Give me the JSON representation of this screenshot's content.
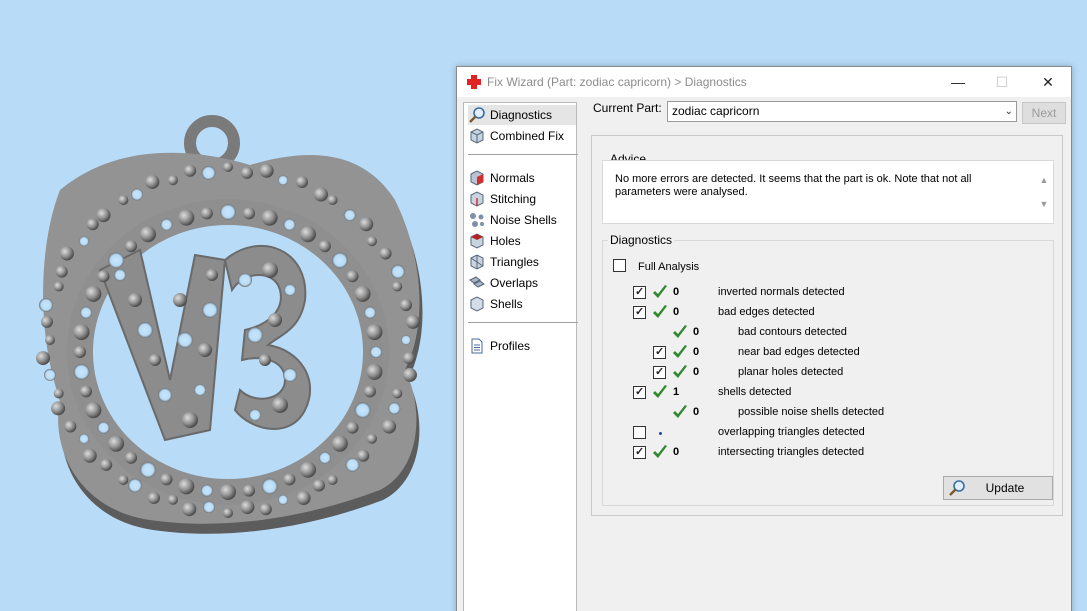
{
  "window": {
    "title": "Fix Wizard (Part: zodiac capricorn) > Diagnostics",
    "controls": {
      "minimize": "—",
      "maximize": "☐",
      "close": "✕"
    }
  },
  "nav": {
    "items": [
      {
        "label": "Diagnostics",
        "icon": "magnifier-icon",
        "selected": true
      },
      {
        "label": "Combined Fix",
        "icon": "cube-icon"
      },
      {
        "label": "Normals",
        "icon": "normals-icon"
      },
      {
        "label": "Stitching",
        "icon": "stitching-icon"
      },
      {
        "label": "Noise Shells",
        "icon": "noise-shells-icon"
      },
      {
        "label": "Holes",
        "icon": "holes-icon"
      },
      {
        "label": "Triangles",
        "icon": "triangles-icon"
      },
      {
        "label": "Overlaps",
        "icon": "overlaps-icon"
      },
      {
        "label": "Shells",
        "icon": "shells-icon"
      },
      {
        "label": "Profiles",
        "icon": "document-icon"
      }
    ]
  },
  "current_part": {
    "label": "Current Part:",
    "value": "zodiac capricorn"
  },
  "next_label": "Next",
  "advice": {
    "title": "Advice",
    "text": "No more errors are detected. It seems that the part is ok. Note that not all parameters were analysed."
  },
  "diagnostics": {
    "title": "Diagnostics",
    "full_analysis": {
      "label": "Full Analysis",
      "checked": false
    },
    "rows": [
      {
        "checkbox": true,
        "checked": true,
        "status": "ok",
        "count": "0",
        "label": "inverted normals detected",
        "indent": 0
      },
      {
        "checkbox": true,
        "checked": true,
        "status": "ok",
        "count": "0",
        "label": "bad edges detected",
        "indent": 0
      },
      {
        "checkbox": false,
        "checked": false,
        "status": "ok",
        "count": "0",
        "label": "bad contours detected",
        "indent": 1
      },
      {
        "checkbox": true,
        "checked": true,
        "status": "ok",
        "count": "0",
        "label": "near bad edges detected",
        "indent": 1
      },
      {
        "checkbox": true,
        "checked": true,
        "status": "ok",
        "count": "0",
        "label": "planar holes detected",
        "indent": 1
      },
      {
        "checkbox": true,
        "checked": true,
        "status": "ok",
        "count": "1",
        "label": "shells detected",
        "indent": 0
      },
      {
        "checkbox": false,
        "checked": false,
        "status": "ok",
        "count": "0",
        "label": "possible noise shells detected",
        "indent": 1
      },
      {
        "checkbox": true,
        "checked": false,
        "status": "none",
        "count": "",
        "label": "overlapping triangles detected",
        "indent": 0
      },
      {
        "checkbox": true,
        "checked": true,
        "status": "ok",
        "count": "0",
        "label": "intersecting triangles detected",
        "indent": 0
      }
    ]
  },
  "update_label": "Update",
  "colors": {
    "background": "#b8dcf8",
    "ok_green": "#2f8a2f",
    "model_gray": "#8a8a8a"
  }
}
